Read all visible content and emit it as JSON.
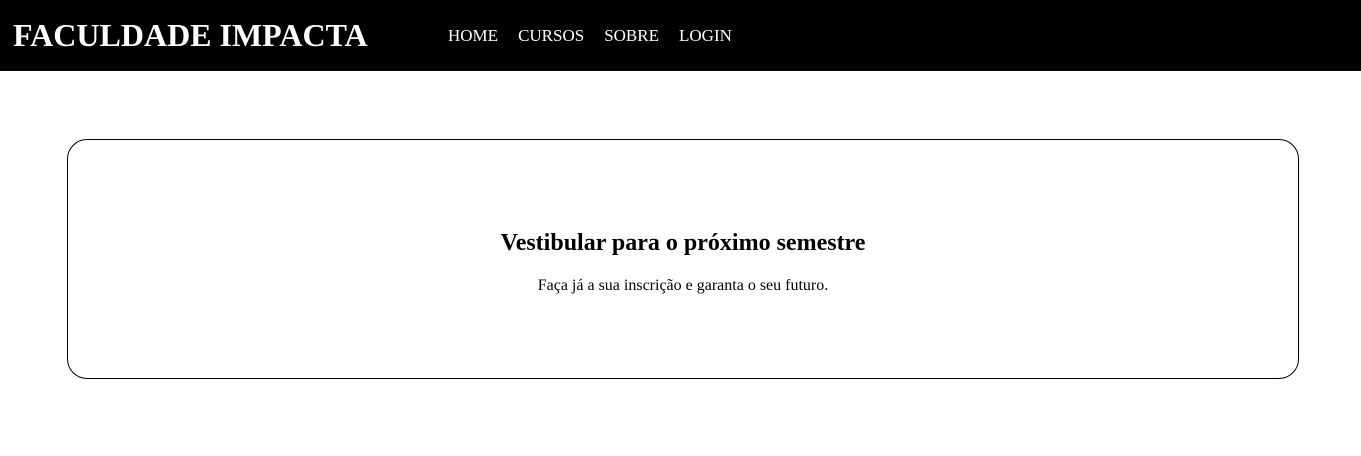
{
  "header": {
    "brand": "FACULDADE IMPACTA",
    "nav": [
      {
        "label": "HOME"
      },
      {
        "label": "CURSOS"
      },
      {
        "label": "SOBRE"
      },
      {
        "label": "LOGIN"
      }
    ]
  },
  "banner": {
    "title": "Vestibular para o próximo semestre",
    "subtitle": "Faça já a sua inscrição e garanta o seu futuro."
  },
  "colors": {
    "header_bg": "#000000",
    "header_text": "#ffffff",
    "page_bg": "#ffffff",
    "text": "#000000"
  }
}
